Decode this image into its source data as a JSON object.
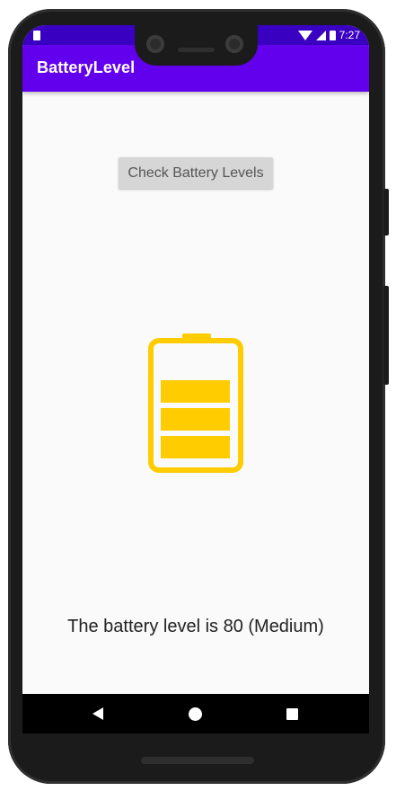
{
  "status_bar": {
    "time": "7:27"
  },
  "app_bar": {
    "title": "BatteryLevel"
  },
  "main": {
    "check_button_label": "Check Battery Levels",
    "battery_icon": {
      "name": "battery-icon",
      "color": "#ffcc00",
      "filled_bars": 3,
      "total_bars": 4
    },
    "level_text": "The battery level is 80 (Medium)"
  },
  "colors": {
    "status_bar": "#3a00c2",
    "app_bar": "#6200ee",
    "background": "#fafafa",
    "battery": "#ffcc00"
  }
}
